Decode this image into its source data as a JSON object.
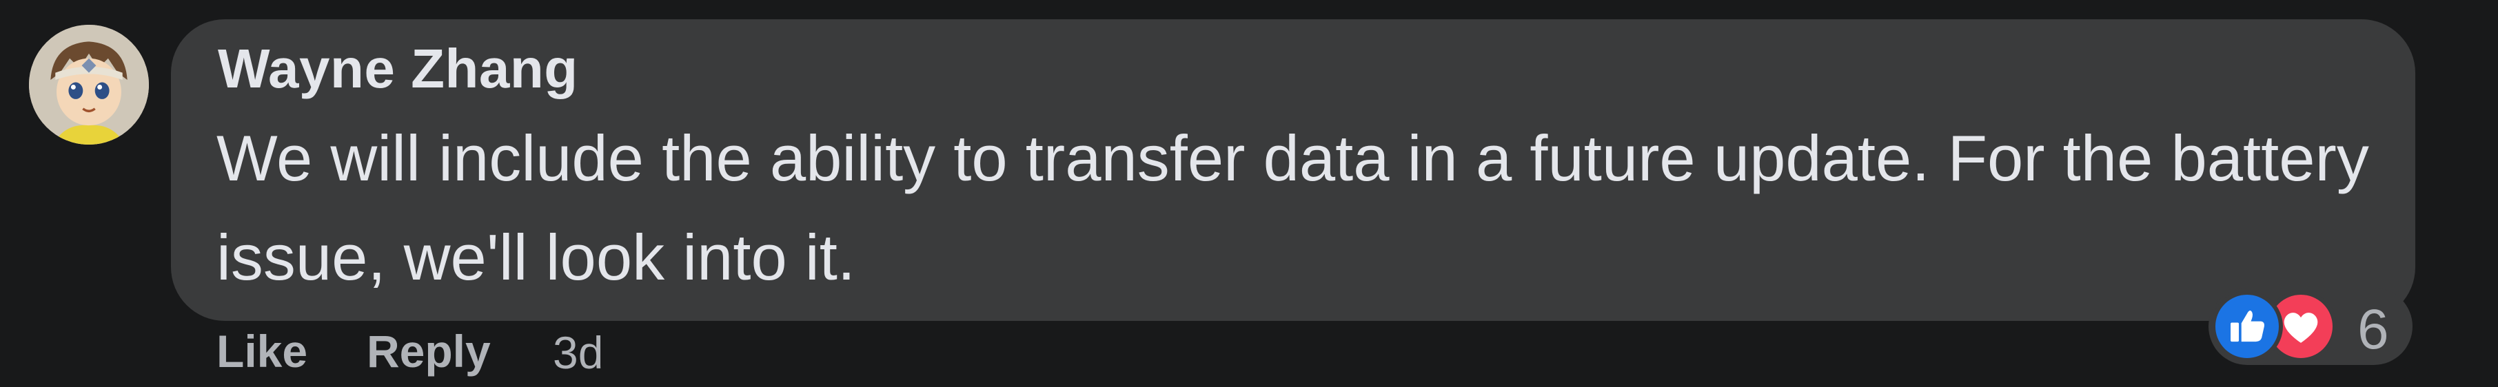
{
  "comment": {
    "author": "Wayne Zhang",
    "text": "We will include the ability to transfer data in a future update. For the battery issue, we'll look into it.",
    "timestamp": "3d"
  },
  "actions": {
    "like_label": "Like",
    "reply_label": "Reply"
  },
  "reactions": {
    "count": "6",
    "types": [
      "like-icon",
      "love-icon"
    ]
  },
  "colors": {
    "background": "#18191a",
    "bubble": "#3a3b3c",
    "primary_text": "#e4e6eb",
    "secondary_text": "#b0b3b8",
    "like_blue": "#1b74e4",
    "love_red": "#f33e58"
  }
}
